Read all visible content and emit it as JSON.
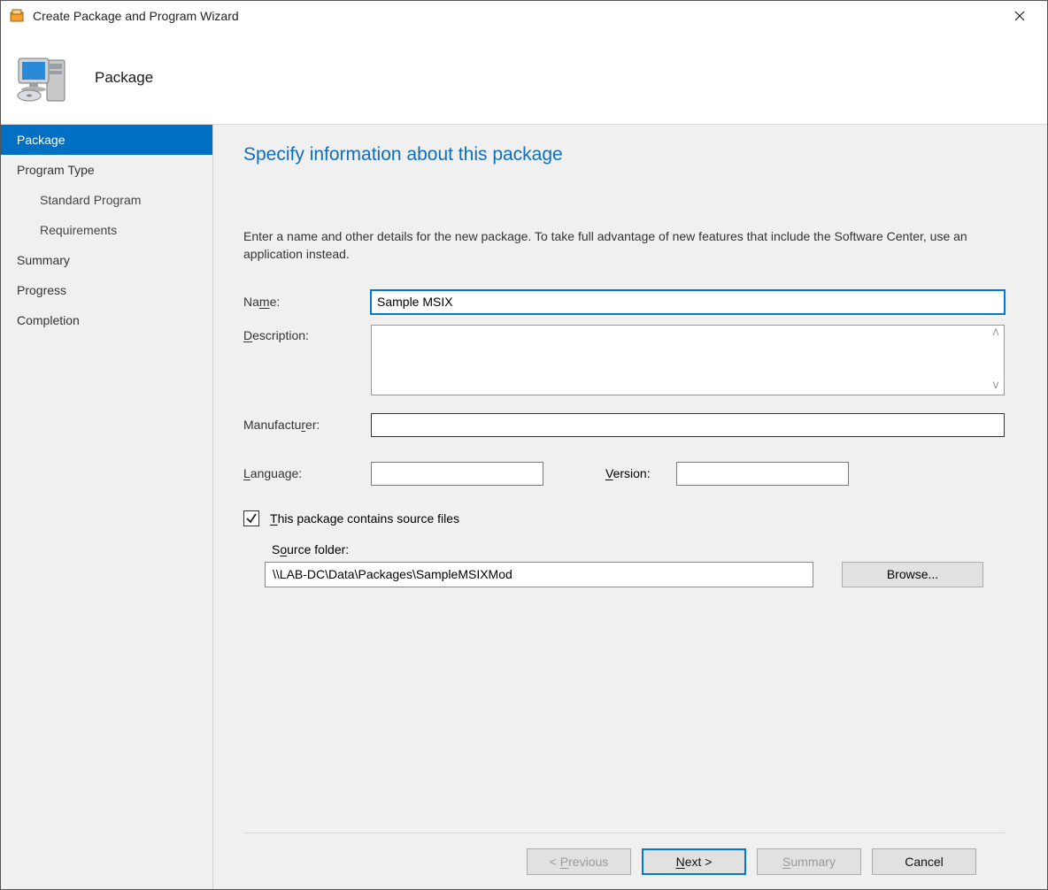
{
  "titlebar": {
    "title": "Create Package and Program Wizard"
  },
  "header": {
    "label": "Package"
  },
  "sidebar": {
    "items": [
      {
        "label": "Package",
        "active": true
      },
      {
        "label": "Program Type"
      },
      {
        "label": "Standard Program",
        "child": true
      },
      {
        "label": "Requirements",
        "child": true
      },
      {
        "label": "Summary"
      },
      {
        "label": "Progress"
      },
      {
        "label": "Completion"
      }
    ]
  },
  "main": {
    "title": "Specify information about this package",
    "instruction": "Enter a name and other details for the new package. To take full advantage of new features that include the Software Center, use an application instead.",
    "labels": {
      "name": "Name:",
      "description": "Description:",
      "manufacturer": "Manufacturer:",
      "language": "Language:",
      "version": "Version:",
      "contains_source": "This package contains source files",
      "source_folder": "Source folder:",
      "browse": "Browse..."
    },
    "values": {
      "name": "Sample MSIX",
      "description": "",
      "manufacturer": "",
      "language": "",
      "version": "",
      "contains_source_checked": true,
      "source_folder": "\\\\LAB-DC\\Data\\Packages\\SampleMSIXMod"
    }
  },
  "footer": {
    "previous": "< Previous",
    "next": "Next >",
    "summary": "Summary",
    "cancel": "Cancel"
  }
}
